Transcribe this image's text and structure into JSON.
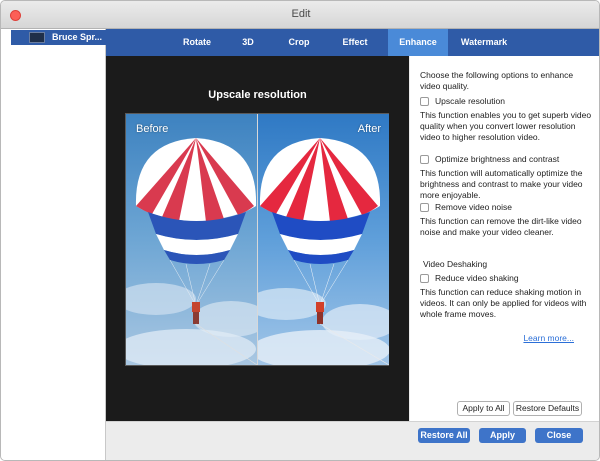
{
  "window": {
    "title": "Edit"
  },
  "sidebar": {
    "file_name": "Bruce Spr..."
  },
  "tabs": [
    {
      "label": "Rotate"
    },
    {
      "label": "3D"
    },
    {
      "label": "Crop"
    },
    {
      "label": "Effect"
    },
    {
      "label": "Enhance"
    },
    {
      "label": "Watermark"
    }
  ],
  "active_tab": "Enhance",
  "preview": {
    "title": "Upscale resolution",
    "before_label": "Before",
    "after_label": "After"
  },
  "options": {
    "intro": "Choose the following options to enhance video quality.",
    "upscale_label": "Upscale resolution",
    "upscale_desc": "This function enables you to get superb video quality when you convert lower resolution video to higher resolution video.",
    "brightness_label": "Optimize brightness and contrast",
    "brightness_desc": "This function will automatically optimize the brightness and contrast to make your video more enjoyable.",
    "noise_label": "Remove video noise",
    "noise_desc": "This function can remove the dirt-like video noise and make your video cleaner.",
    "deshake_heading": "Video Deshaking",
    "shake_label": "Reduce video shaking",
    "shake_desc": "This function can reduce shaking motion in videos. It can only be applied for videos with whole frame moves.",
    "learn_more": "Learn more...",
    "apply_all": "Apply to All",
    "restore_defaults": "Restore Defaults"
  },
  "footer": {
    "restore_all": "Restore All",
    "apply": "Apply",
    "close": "Close"
  },
  "colors": {
    "accent": "#2f5ba7",
    "active_tab": "#4a8ad8",
    "button": "#3e74c9",
    "link": "#2b6fd8"
  }
}
